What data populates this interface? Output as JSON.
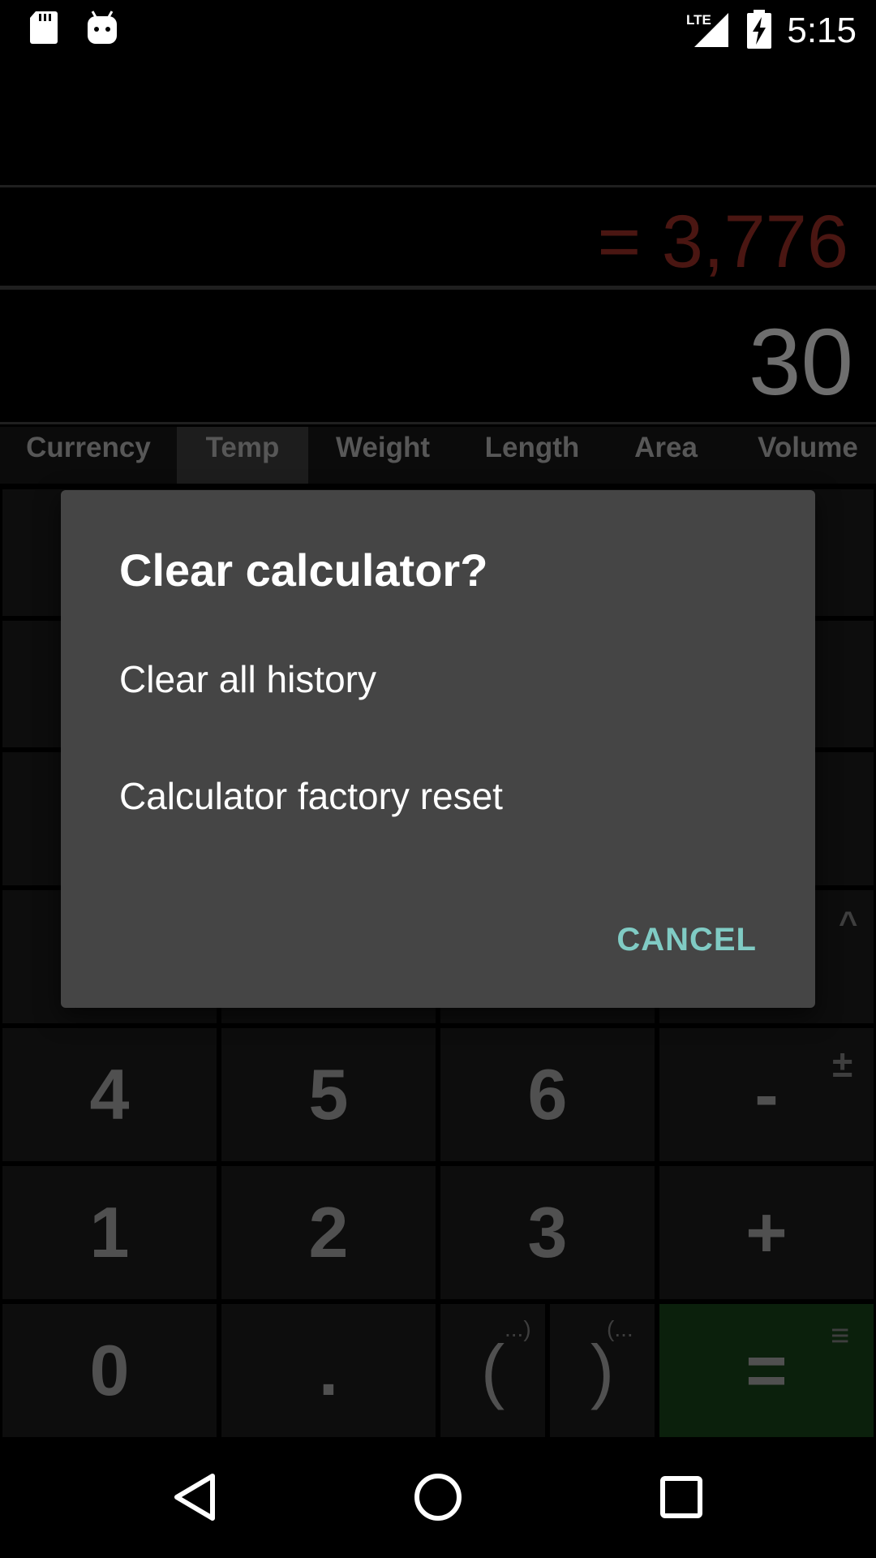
{
  "status_bar": {
    "time": "5:15",
    "network": "LTE",
    "icons": [
      "sd-card-icon",
      "android-debug-icon",
      "lte-signal-icon",
      "battery-charging-icon"
    ]
  },
  "display": {
    "result": "= 3,776",
    "expression": "30"
  },
  "tabs": [
    {
      "label": "Currency"
    },
    {
      "label": "Temp",
      "active": true
    },
    {
      "label": "Weight"
    },
    {
      "label": "Length"
    },
    {
      "label": "Area"
    },
    {
      "label": "Volume"
    }
  ],
  "keypad": {
    "k4": "4",
    "k5": "5",
    "k6": "6",
    "minus": "-",
    "plus_minus": "±",
    "k1": "1",
    "k2": "2",
    "k3": "3",
    "plus": "+",
    "k0": "0",
    "dot": ".",
    "open_paren": "(",
    "close_paren": ")",
    "open_paren_hint": "...)",
    "close_paren_hint": "(...",
    "equals": "=",
    "equals_menu": "≡",
    "caret": "^"
  },
  "dialog": {
    "title": "Clear calculator?",
    "options": [
      "Clear all history",
      "Calculator factory reset"
    ],
    "cancel_label": "CANCEL"
  },
  "colors": {
    "dialog_bg": "#454545",
    "accent": "#80cbc4",
    "result_text": "#4a1612",
    "equals_key": "#0b200c"
  }
}
